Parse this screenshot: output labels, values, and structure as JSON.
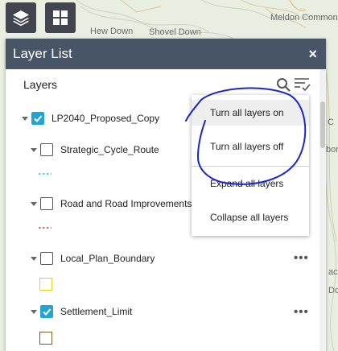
{
  "map": {
    "labels": {
      "meldon_common": "Meldon Common",
      "hew_down": "Hew Down",
      "shovel_down": "Shovel Down",
      "edge_c": "C",
      "edge_bor": "bor",
      "edge_ac": "ac",
      "edge_do": "Do"
    }
  },
  "tools": {
    "layers_icon": "layers-icon",
    "basemap_icon": "grid-icon"
  },
  "panel": {
    "title": "Layer List",
    "close_label": "×",
    "layers_heading": "Layers"
  },
  "layers": [
    {
      "label": "LP2040_Proposed_Copy",
      "checked": true
    },
    {
      "label": "Strategic_Cycle_Route",
      "checked": false
    },
    {
      "label": "Road and Road Improvements",
      "checked": false
    },
    {
      "label": "Local_Plan_Boundary",
      "checked": false
    },
    {
      "label": "Settlement_Limit",
      "checked": true
    }
  ],
  "more_label": "•••",
  "menu": {
    "items": [
      "Turn all layers on",
      "Turn all layers off",
      "Expand all layers",
      "Collapse all layers"
    ]
  },
  "colors": {
    "header": "#485566",
    "accent": "#23a4d6",
    "annotation": "#1b25c9",
    "cycle_route": "#2ec4c4",
    "road": "#c0522b",
    "boundary": "#e6d21a",
    "settlement": "#7a5a2a"
  }
}
